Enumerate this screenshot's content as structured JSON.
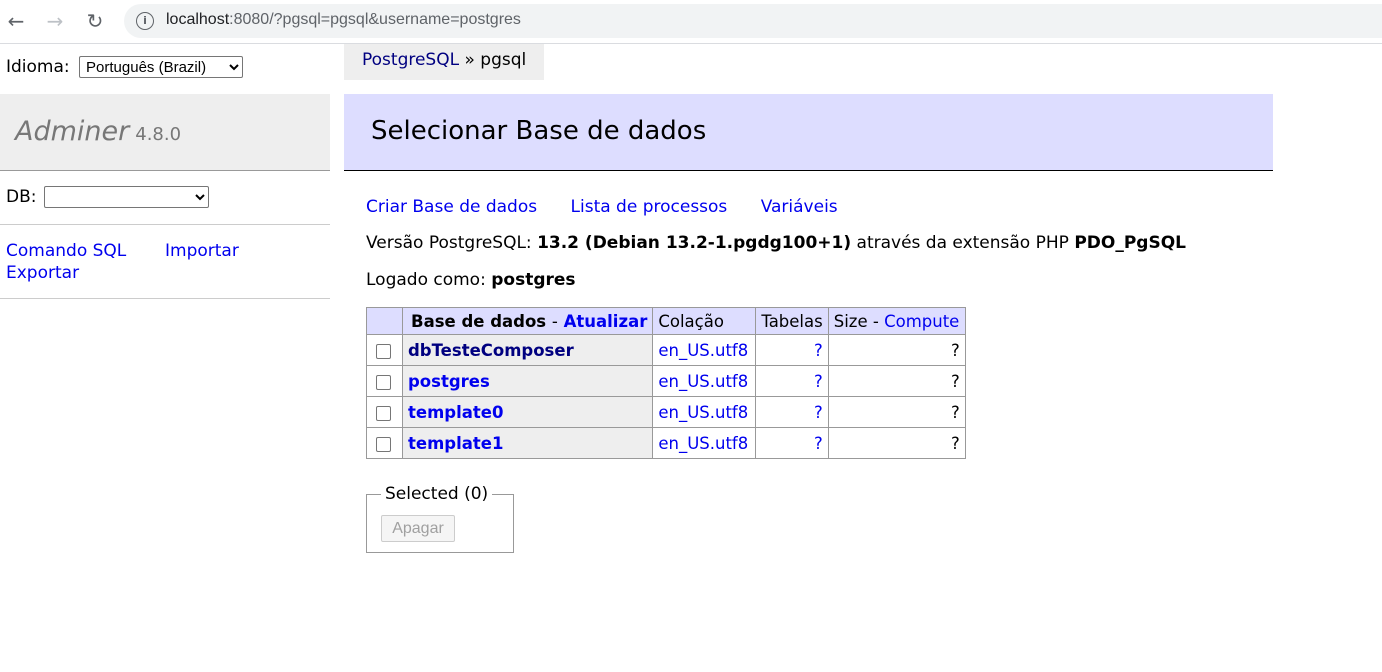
{
  "browser": {
    "url_host": "localhost",
    "url_rest": ":8080/?pgsql=pgsql&username=postgres"
  },
  "sidebar": {
    "language_label": "Idioma:",
    "language_value": "Português (Brazil)",
    "app_name": "Adminer",
    "app_version": "4.8.0",
    "db_label": "DB:",
    "db_value": "",
    "links": {
      "sql_command": "Comando SQL",
      "import": "Importar",
      "export": "Exportar"
    }
  },
  "breadcrumb": {
    "driver": "PostgreSQL",
    "separator": "»",
    "server": "pgsql"
  },
  "main": {
    "title": "Selecionar Base de dados",
    "actions": [
      "Criar Base de dados",
      "Lista de processos",
      "Variáveis"
    ],
    "version_prefix": "Versão PostgreSQL:",
    "version_value": "13.2 (Debian 13.2-1.pgdg100+1)",
    "version_mid": "através da extensão PHP",
    "version_ext": "PDO_PgSQL",
    "logged_label": "Logado como:",
    "logged_user": "postgres"
  },
  "table": {
    "col_database": "Base de dados",
    "col_dash": "-",
    "col_refresh": "Atualizar",
    "col_collation": "Colação",
    "col_tables": "Tabelas",
    "col_size": "Size",
    "col_compute": "Compute",
    "rows": [
      {
        "name": "dbTesteComposer",
        "collation": "en_US.utf8",
        "tables": "?",
        "size": "?"
      },
      {
        "name": "postgres",
        "collation": "en_US.utf8",
        "tables": "?",
        "size": "?"
      },
      {
        "name": "template0",
        "collation": "en_US.utf8",
        "tables": "?",
        "size": "?"
      },
      {
        "name": "template1",
        "collation": "en_US.utf8",
        "tables": "?",
        "size": "?"
      }
    ]
  },
  "selected": {
    "legend": "Selected (0)",
    "delete_button": "Apagar"
  }
}
